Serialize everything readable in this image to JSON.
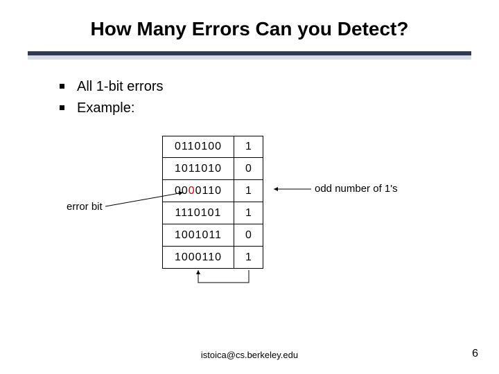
{
  "title": "How Many Errors Can you Detect?",
  "bullets": [
    "All 1-bit errors",
    "Example:"
  ],
  "rows": [
    {
      "pre": "",
      "red": "",
      "post": "0110100",
      "parity": "1"
    },
    {
      "pre": "",
      "red": "",
      "post": "1011010",
      "parity": "0"
    },
    {
      "pre": "00",
      "red": "0",
      "post": "0110",
      "parity": "1"
    },
    {
      "pre": "",
      "red": "",
      "post": "1110101",
      "parity": "1"
    },
    {
      "pre": "",
      "red": "",
      "post": "1001011",
      "parity": "0"
    },
    {
      "pre": "",
      "red": "",
      "post": "1000110",
      "parity": "1"
    }
  ],
  "annotation_error_bit": "error bit",
  "annotation_odd": "odd number of 1's",
  "footer_email": "istoica@cs.berkeley.edu",
  "page_number": "6"
}
